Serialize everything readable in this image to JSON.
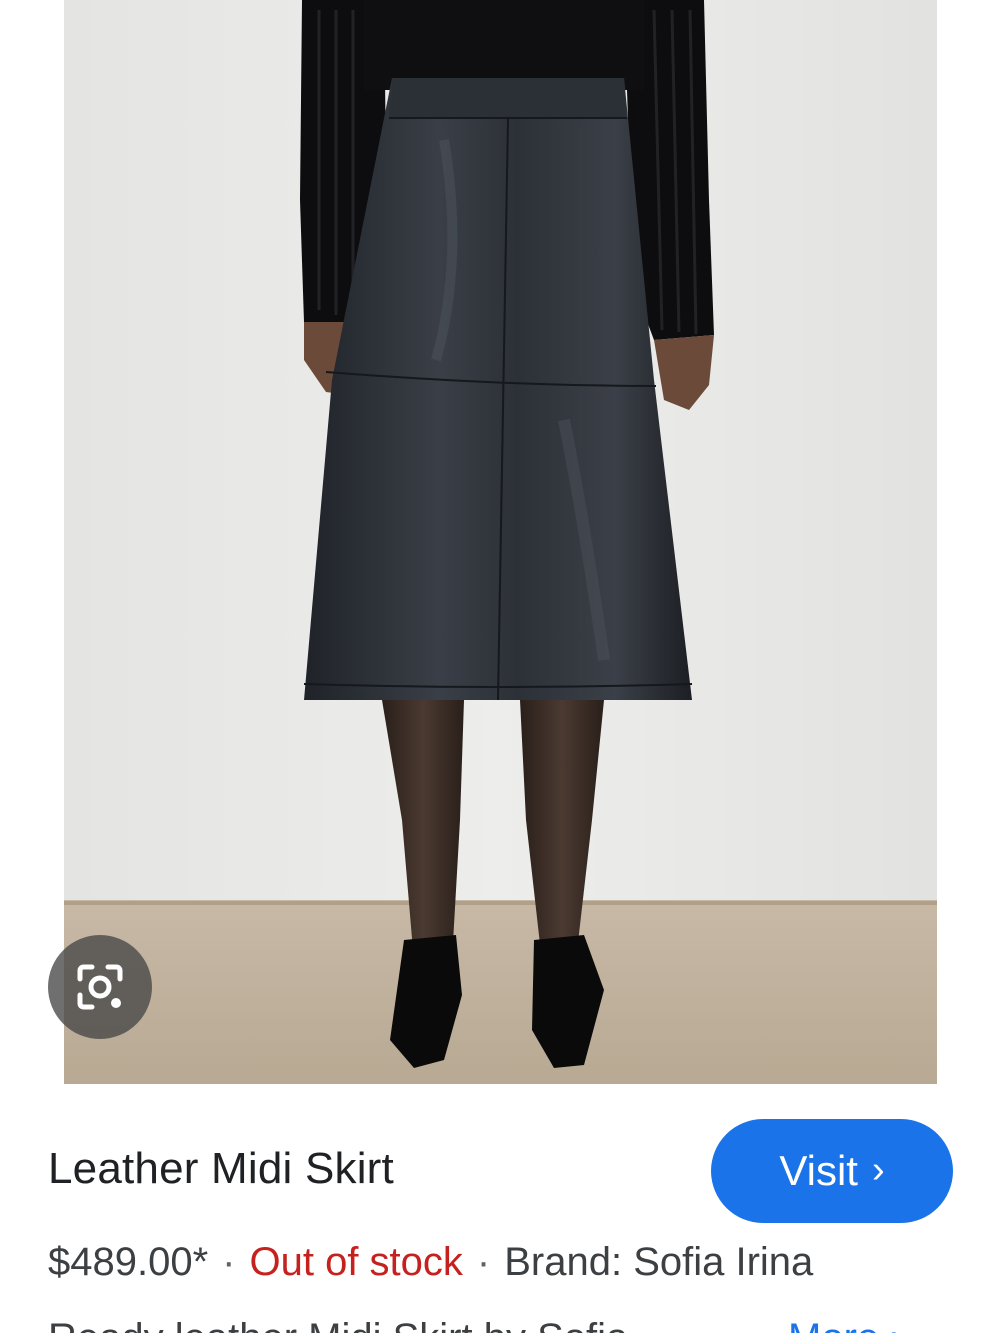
{
  "product": {
    "title": "Leather Midi Skirt",
    "price": "$489.00*",
    "separator": "·",
    "stock_status": "Out of stock",
    "brand": "Brand: Sofia Irina",
    "description_preview": "Ready leather Midi Skirt by Sofia",
    "more_label": "More ›"
  },
  "actions": {
    "visit_label": "Visit",
    "visit_chevron": "›"
  },
  "icons": {
    "lens": "google-lens-icon",
    "visit_chevron": "chevron-right-icon"
  },
  "colors": {
    "accent": "#1a73e8",
    "out_of_stock": "#c5221f",
    "text": "#202124"
  }
}
